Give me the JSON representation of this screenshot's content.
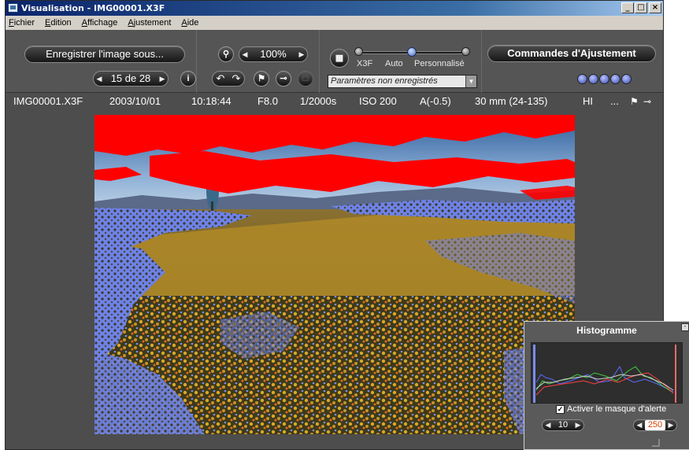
{
  "window": {
    "title": "Visualisation - IMG00001.X3F",
    "minimize": "_",
    "maximize": "□",
    "close": "×"
  },
  "menu": [
    "Fichier",
    "Edition",
    "Affichage",
    "Ajustement",
    "Aide"
  ],
  "toolbar": {
    "save_as": "Enregistrer l'image sous...",
    "zoom": "100%",
    "navigator": "15 de 28",
    "info_icon": "info-icon",
    "adjust_controls": "Commandes d'Ajustement",
    "mode_labels": [
      "X3F",
      "Auto",
      "Personnalisé"
    ],
    "preset_dropdown": "Paramètres non enregistrés",
    "rating_dots": 5
  },
  "info": {
    "filename": "IMG00001.X3F",
    "date": "2003/10/01",
    "time": "10:18:44",
    "aperture": "F8.0",
    "shutter": "1/2000s",
    "iso": "ISO 200",
    "exposure": "A(-0.5)",
    "focal": "30 mm (24-135)",
    "quality": "HI",
    "more": "..."
  },
  "histogram": {
    "title": "Histogramme",
    "alert_mask_label": "Activer le masque d'alerte",
    "alert_mask_checked": true,
    "low_threshold": "10",
    "high_threshold": "250"
  },
  "colors": {
    "highlight_warning": "#ff0000",
    "shadow_warning": "#7b8cf0",
    "background": "#4d4d4d"
  }
}
